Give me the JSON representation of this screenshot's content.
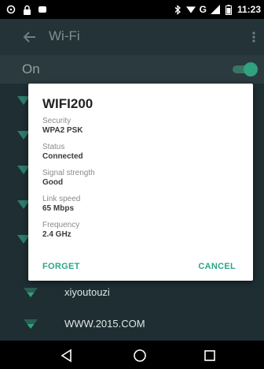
{
  "status_bar": {
    "time": "11:23",
    "network": "G"
  },
  "header": {
    "title": "Wi-Fi"
  },
  "toggle_row": {
    "label": "On",
    "state": "on"
  },
  "networks": [
    {
      "name": "xiyoutouzi"
    },
    {
      "name": "WWW.2015.COM"
    }
  ],
  "dialog": {
    "title": "WIFI200",
    "fields": [
      {
        "label": "Security",
        "value": "WPA2 PSK"
      },
      {
        "label": "Status",
        "value": "Connected"
      },
      {
        "label": "Signal strength",
        "value": "Good"
      },
      {
        "label": "Link speed",
        "value": "65 Mbps"
      },
      {
        "label": "Frequency",
        "value": "2.4 GHz"
      }
    ],
    "buttons": {
      "forget": "FORGET",
      "cancel": "CANCEL"
    }
  },
  "colors": {
    "accent": "#2aa588",
    "background": "#1e2e33",
    "toggle_thumb": "#31a27f"
  }
}
